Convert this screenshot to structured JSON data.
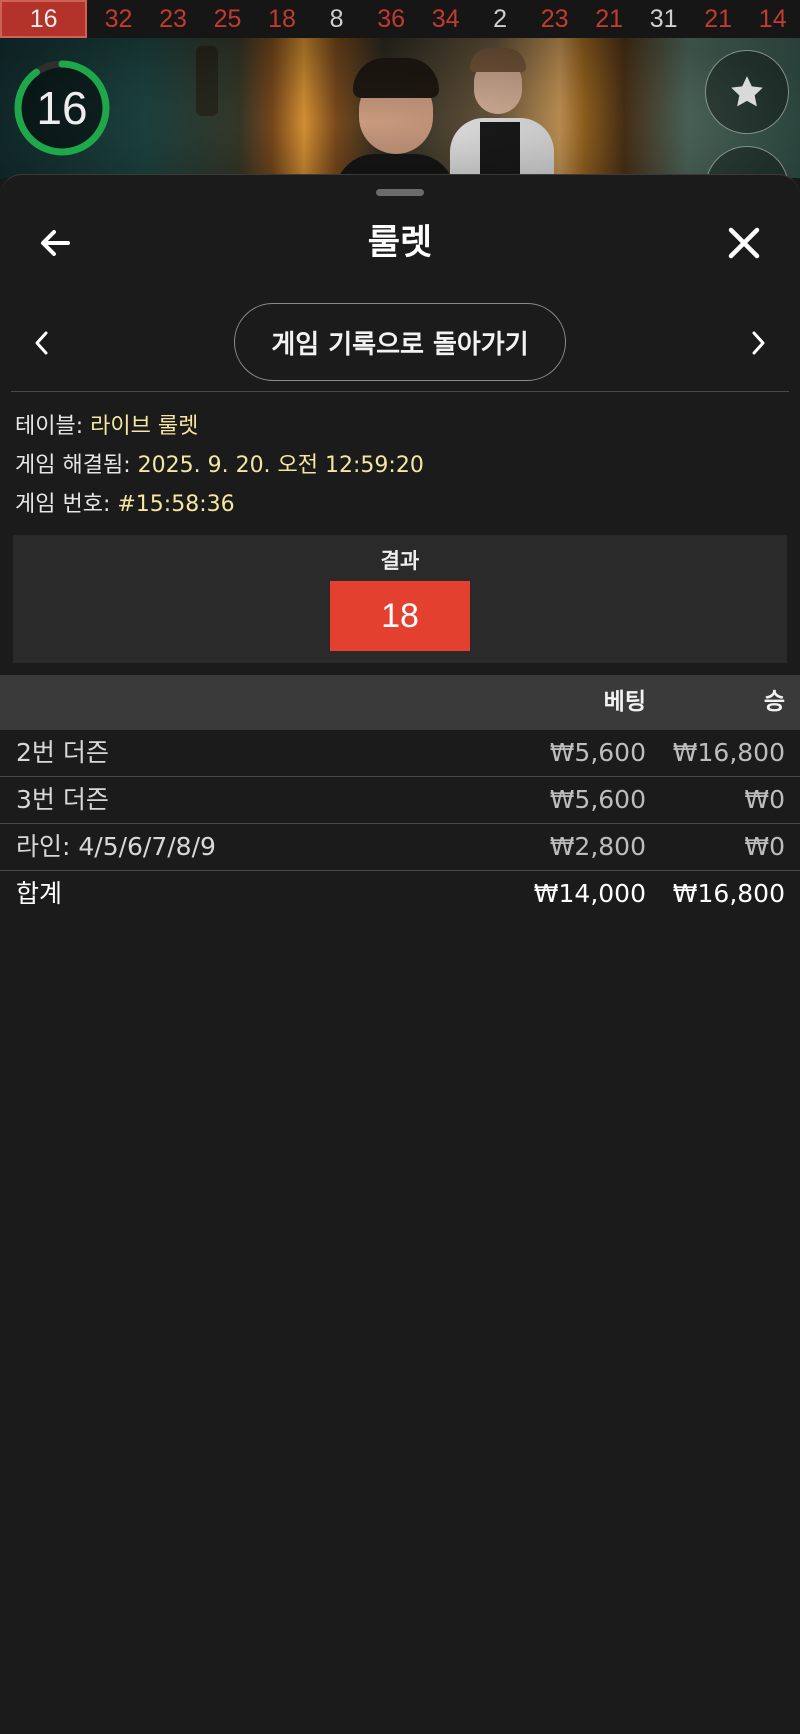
{
  "history": {
    "current": "16",
    "numbers": [
      {
        "value": "32",
        "color": "red"
      },
      {
        "value": "23",
        "color": "red"
      },
      {
        "value": "25",
        "color": "red"
      },
      {
        "value": "18",
        "color": "red"
      },
      {
        "value": "8",
        "color": "black"
      },
      {
        "value": "36",
        "color": "red"
      },
      {
        "value": "34",
        "color": "red"
      },
      {
        "value": "2",
        "color": "black"
      },
      {
        "value": "23",
        "color": "red"
      },
      {
        "value": "21",
        "color": "red"
      },
      {
        "value": "31",
        "color": "black"
      },
      {
        "value": "21",
        "color": "red"
      },
      {
        "value": "14",
        "color": "red"
      }
    ]
  },
  "video": {
    "countdown": "16",
    "countdown_progress": 0.9
  },
  "sheet": {
    "title": "룰렛",
    "back_to_history": "게임 기록으로 돌아가기",
    "info": {
      "table_label": "테이블:",
      "table_value": "라이브 룰렛",
      "resolved_label": "게임 해결됨:",
      "resolved_value": "2025. 9. 20. 오전 12:59:20",
      "game_no_label": "게임 번호:",
      "game_no_value": "#15:58:36"
    },
    "result": {
      "label": "결과",
      "number": "18"
    },
    "bets": {
      "header": {
        "name": "",
        "bet": "베팅",
        "win": "승"
      },
      "rows": [
        {
          "name": "2번 더즌",
          "bet": "₩5,600",
          "win": "₩16,800"
        },
        {
          "name": "3번 더즌",
          "bet": "₩5,600",
          "win": "₩0"
        },
        {
          "name": "라인: 4/5/6/7/8/9",
          "bet": "₩2,800",
          "win": "₩0"
        }
      ],
      "total": {
        "name": "합계",
        "bet": "₩14,000",
        "win": "₩16,800"
      }
    }
  },
  "colors": {
    "red_number": "#c33b2f",
    "result_red": "#e3402f",
    "info_value": "#f6e6a0",
    "countdown_ring": "#1fa84a"
  },
  "icons": {
    "back": "arrow-left-icon",
    "close": "close-icon",
    "prev": "chevron-left-icon",
    "next": "chevron-right-icon",
    "favorite": "star-icon"
  }
}
